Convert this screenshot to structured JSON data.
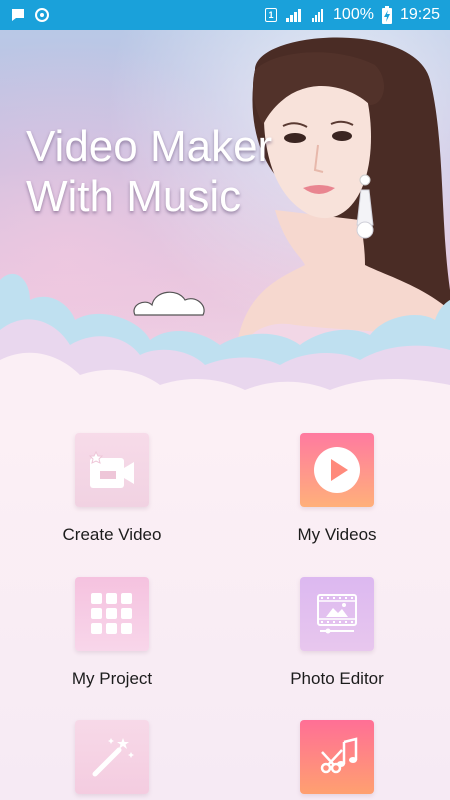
{
  "status_bar": {
    "sim_label": "1",
    "battery": "100%",
    "time": "19:25"
  },
  "hero": {
    "title_line1": "Video Maker",
    "title_line2": "With Music"
  },
  "menu": {
    "create_video": "Create Video",
    "my_videos": "My Videos",
    "my_project": "My Project",
    "photo_editor": "Photo Editor"
  },
  "colors": {
    "status_bar": "#1aa1da",
    "accent_pink": "#ff7aa0",
    "accent_orange": "#ffb07a"
  }
}
